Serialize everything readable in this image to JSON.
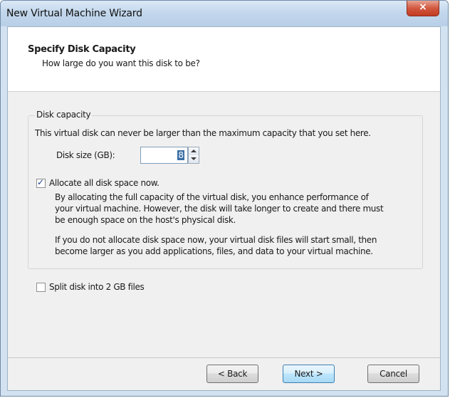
{
  "window": {
    "title": "New Virtual Machine Wizard",
    "close_glyph": "×"
  },
  "header": {
    "title": "Specify Disk Capacity",
    "subtitle": "How large do you want this disk to be?"
  },
  "disk_capacity": {
    "legend": "Disk capacity",
    "description": "This virtual disk can never be larger than the maximum capacity that you set here.",
    "size_label": "Disk size (GB):",
    "size_value": "8"
  },
  "allocate": {
    "label": "Allocate all disk space now.",
    "checked": true,
    "check_glyph": "✓",
    "para1": [
      "By allocating the full capacity of the virtual disk, you enhance performance of",
      "your virtual machine.  However, the disk will take longer to create and there must",
      "be enough space on the host's physical disk."
    ],
    "para2": [
      "If you do not allocate disk space now, your virtual disk files will start small, then",
      "become larger as you add applications, files, and data to your virtual machine."
    ]
  },
  "split": {
    "label": "Split disk into 2 GB files",
    "checked": false
  },
  "buttons": {
    "back": "< Back",
    "next": "Next >",
    "cancel": "Cancel"
  },
  "colors": {
    "titlebar": "#c3d7ec",
    "close": "#c23b22",
    "default_button": "#bee6fd",
    "selection": "#3a6ea5"
  }
}
